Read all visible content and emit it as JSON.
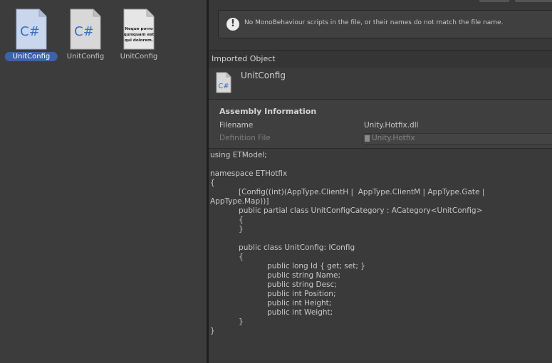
{
  "project": {
    "assets": [
      {
        "name": "UnitConfig",
        "icon": "csharp-script-icon",
        "selected": true
      },
      {
        "name": "UnitConfig",
        "icon": "csharp-script-icon",
        "selected": false
      },
      {
        "name": "UnitConfig",
        "icon": "text-asset-icon",
        "selected": false,
        "preview_text": "Neque porro quisquam est qui dolorem."
      }
    ],
    "csharp_glyph": "C#"
  },
  "inspector": {
    "help_message": "No MonoBehaviour scripts in the file, or their names do not match the file name.",
    "help_icon_glyph": "!",
    "imported_header": "Imported Object",
    "object_name": "UnitConfig",
    "assembly": {
      "title": "Assembly Information",
      "filename_label": "Filename",
      "filename_value": "Unity.Hotfix.dll",
      "definition_label": "Definition File",
      "definition_value": "Unity.Hotfix"
    },
    "code_lines": [
      "using ETModel;",
      "",
      "namespace ETHotfix",
      "{",
      "            [Config((int)(AppType.ClientH |  AppType.ClientM | AppType.Gate |",
      "AppType.Map))]",
      "            public partial class UnitConfigCategory : ACategory<UnitConfig>",
      "            {",
      "            }",
      "",
      "            public class UnitConfig: IConfig",
      "            {",
      "                        public long Id { get; set; }",
      "                        public string Name;",
      "                        public string Desc;",
      "                        public int Position;",
      "                        public int Height;",
      "                        public int Weight;",
      "            }",
      "}"
    ]
  },
  "colors": {
    "selection": "#3e63a5",
    "csharp_blue": "#3a6fc4",
    "panel": "#383838"
  }
}
